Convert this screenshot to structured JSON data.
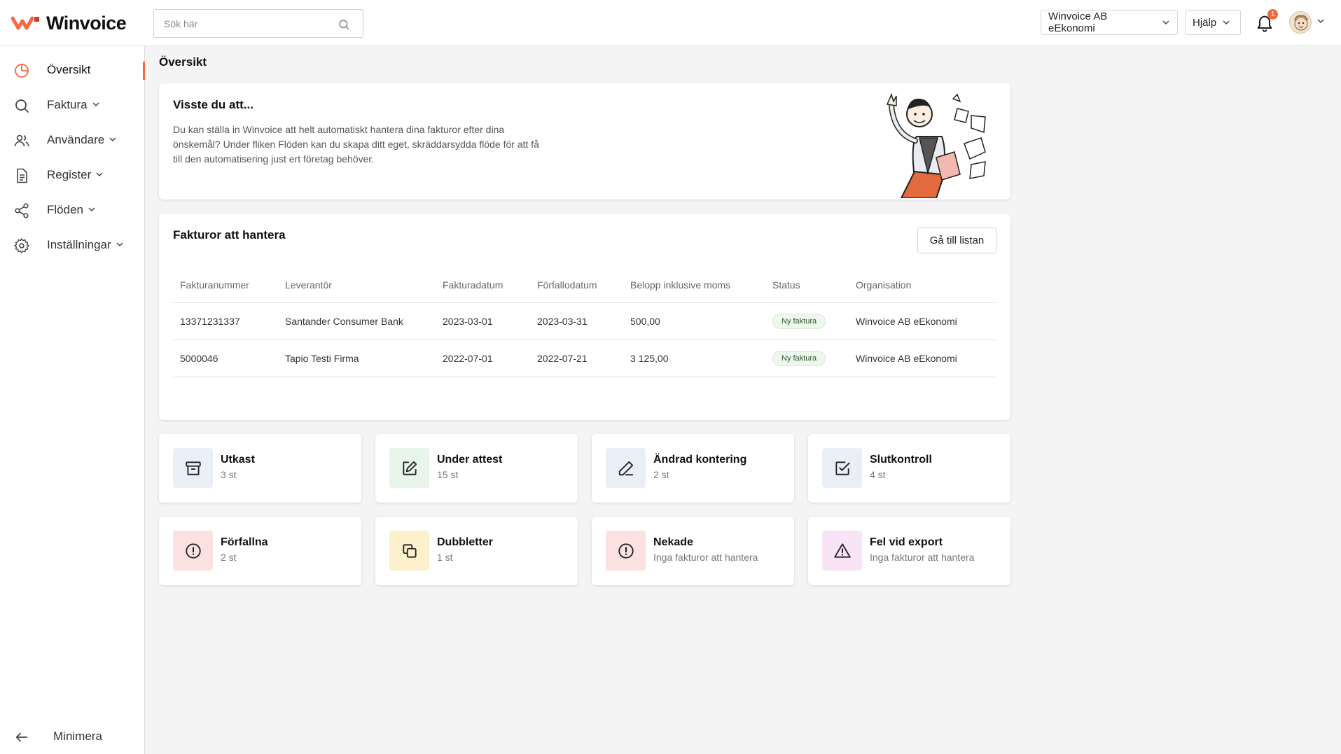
{
  "app": {
    "name": "Winvoice",
    "brand_color": "#f26a3d"
  },
  "search": {
    "placeholder": "Sök här",
    "value": ""
  },
  "header": {
    "org_selector": "Winvoice AB eEkonomi",
    "help_label": "Hjälp",
    "notification_count": "1"
  },
  "sidebar": {
    "items": [
      {
        "label": "Översikt",
        "icon": "pie-chart-icon",
        "active": true
      },
      {
        "label": "Faktura",
        "icon": "search-icon"
      },
      {
        "label": "Användare",
        "icon": "users-icon"
      },
      {
        "label": "Register",
        "icon": "document-icon"
      },
      {
        "label": "Flöden",
        "icon": "share-icon"
      },
      {
        "label": "Inställningar",
        "icon": "gear-icon"
      }
    ],
    "minimize_label": "Minimera"
  },
  "page": {
    "title": "Översikt"
  },
  "tip": {
    "title": "Visste du att...",
    "text": "Du kan ställa in Winvoice att helt automatiskt hantera dina fakturor efter dina önskemål? Under fliken Flöden kan du skapa ditt eget, skräddarsydda flöde för att få till den automatisering just ert företag behöver."
  },
  "invoices": {
    "title": "Fakturor att hantera",
    "goto_label": "Gå till listan",
    "columns": [
      "Fakturanummer",
      "Leverantör",
      "Fakturadatum",
      "Förfallodatum",
      "Belopp inklusive moms",
      "Status",
      "Organisation"
    ],
    "rows": [
      {
        "number": "13371231337",
        "supplier": "Santander Consumer Bank",
        "invoice_date": "2023-03-01",
        "due_date": "2023-03-31",
        "amount": "500,00",
        "status": "Ny faktura",
        "organisation": "Winvoice AB eEkonomi"
      },
      {
        "number": "5000046",
        "supplier": "Tapio Testi Firma",
        "invoice_date": "2022-07-01",
        "due_date": "2022-07-21",
        "amount": "3 125,00",
        "status": "Ny faktura",
        "organisation": "Winvoice AB eEkonomi"
      }
    ]
  },
  "tiles": [
    {
      "title": "Utkast",
      "sub": "3 st",
      "icon": "archive-icon",
      "bg": "#e9eef7"
    },
    {
      "title": "Under attest",
      "sub": "15 st",
      "icon": "edit-icon",
      "bg": "#e8f5ea"
    },
    {
      "title": "Ändrad kontering",
      "sub": "2 st",
      "icon": "pen-icon",
      "bg": "#e9eef7"
    },
    {
      "title": "Slutkontroll",
      "sub": "4 st",
      "icon": "check-square-icon",
      "bg": "#e9eef7"
    },
    {
      "title": "Förfallna",
      "sub": "2 st",
      "icon": "alert-circle-icon",
      "bg": "#fbe1e1"
    },
    {
      "title": "Dubbletter",
      "sub": "1 st",
      "icon": "copy-icon",
      "bg": "#fdf0cc"
    },
    {
      "title": "Nekade",
      "sub": "Inga fakturor att hantera",
      "icon": "alert-circle-icon",
      "bg": "#fbe1e1"
    },
    {
      "title": "Fel vid export",
      "sub": "Inga fakturor att hantera",
      "icon": "warning-triangle-icon",
      "bg": "#f9e3f6"
    }
  ]
}
